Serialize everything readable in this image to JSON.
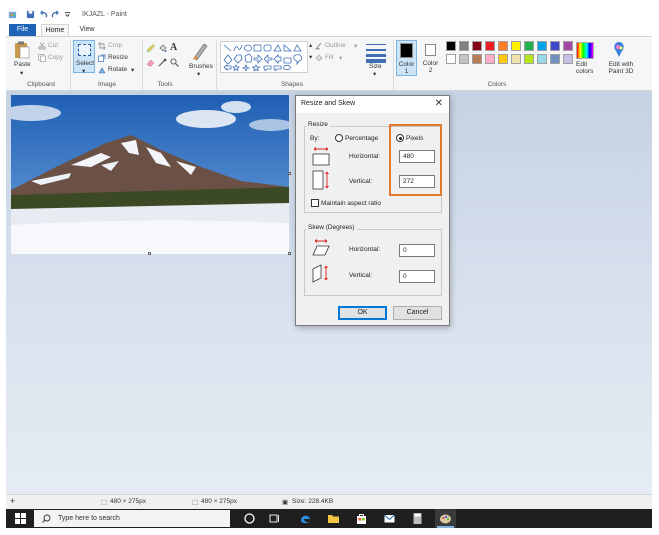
{
  "titlebar": {
    "title": "IKJAZL - Paint"
  },
  "tabs": {
    "file": "File",
    "home": "Home",
    "view": "View"
  },
  "ribbon": {
    "clipboard": {
      "label": "Clipboard",
      "paste": "Paste",
      "cut": "Cut",
      "copy": "Copy"
    },
    "image": {
      "label": "Image",
      "select": "Select",
      "crop": "Crop",
      "resize": "Resize",
      "rotate": "Rotate"
    },
    "tools": {
      "label": "Tools"
    },
    "brushes": {
      "label": "Brushes"
    },
    "shapes": {
      "label": "Shapes",
      "outline": "Outline",
      "fill": "Fill"
    },
    "size": {
      "label": "Size"
    },
    "colors": {
      "label": "Colors",
      "color1": "Color 1",
      "color2": "Color 2",
      "edit_colors": "Edit colors",
      "edit_paint3d": "Edit with Paint 3D",
      "swatches_top": [
        "#000000",
        "#7f7f7f",
        "#880015",
        "#ed1c24",
        "#ff7f27",
        "#fff200",
        "#22b14c",
        "#00a2e8",
        "#3f48cc",
        "#a349a4"
      ],
      "swatches_bottom": [
        "#ffffff",
        "#c3c3c3",
        "#b97a57",
        "#ffaec9",
        "#ffc90e",
        "#efe4b0",
        "#b5e61d",
        "#99d9ea",
        "#7092be",
        "#c8bfe7"
      ]
    }
  },
  "dialog": {
    "title": "Resize and Skew",
    "resize_legend": "Resize",
    "by_label": "By:",
    "percentage": "Percentage",
    "pixels": "Pixels",
    "horizontal_label": "Horizontal:",
    "vertical_label": "Vertical:",
    "horizontal_value": "480",
    "vertical_value": "272",
    "maintain_aspect": "Maintain aspect ratio",
    "skew_legend": "Skew (Degrees)",
    "skew_horizontal_label": "Horizontal:",
    "skew_vertical_label": "Vertical:",
    "skew_horizontal_value": "0",
    "skew_vertical_value": "0",
    "ok": "OK",
    "cancel": "Cancel"
  },
  "statusbar": {
    "selection_size": "480 × 275px",
    "image_size": "480 × 275px",
    "file_size": "Size: 228.4KB"
  },
  "taskbar": {
    "search_placeholder": "Type here to search"
  },
  "colors": {
    "highlight": "#e07a2f",
    "accent": "#1e63b6"
  }
}
